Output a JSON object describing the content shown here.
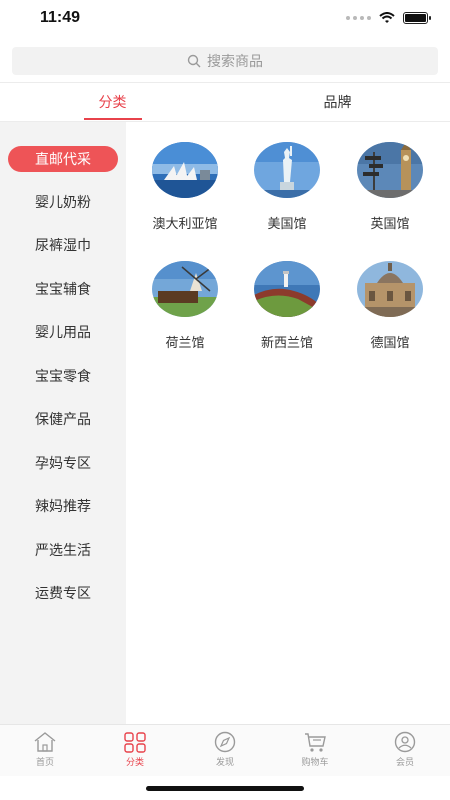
{
  "status_bar": {
    "time": "11:49"
  },
  "search": {
    "placeholder": "搜索商品",
    "icon": "search-icon"
  },
  "tabs": [
    {
      "label": "分类",
      "active": true
    },
    {
      "label": "品牌",
      "active": false
    }
  ],
  "sidebar": {
    "items": [
      {
        "label": "直邮代采",
        "active": true
      },
      {
        "label": "婴儿奶粉"
      },
      {
        "label": "尿裤湿巾"
      },
      {
        "label": "宝宝辅食"
      },
      {
        "label": "婴儿用品"
      },
      {
        "label": "宝宝零食"
      },
      {
        "label": "保健产品"
      },
      {
        "label": "孕妈专区"
      },
      {
        "label": "辣妈推荐"
      },
      {
        "label": "严选生活"
      },
      {
        "label": "运费专区"
      }
    ]
  },
  "pavilions": [
    {
      "name": "澳大利亚馆",
      "image": "sydney-opera-house-photo"
    },
    {
      "name": "美国馆",
      "image": "statue-of-liberty-photo"
    },
    {
      "name": "英国馆",
      "image": "big-ben-photo"
    },
    {
      "name": "荷兰馆",
      "image": "windmill-photo"
    },
    {
      "name": "新西兰馆",
      "image": "lighthouse-coast-photo"
    },
    {
      "name": "德国馆",
      "image": "cathedral-city-photo"
    }
  ],
  "bottom_nav": [
    {
      "label": "首页",
      "icon": "home-icon",
      "active": false
    },
    {
      "label": "分类",
      "icon": "category-grid-icon",
      "active": true
    },
    {
      "label": "发现",
      "icon": "compass-icon",
      "active": false
    },
    {
      "label": "购物车",
      "icon": "cart-icon",
      "active": false
    },
    {
      "label": "会员",
      "icon": "user-icon",
      "active": false
    }
  ],
  "colors": {
    "accent": "#e8424b",
    "sidebar_bg": "#f3f3f3",
    "inactive": "#9a9a9a"
  }
}
